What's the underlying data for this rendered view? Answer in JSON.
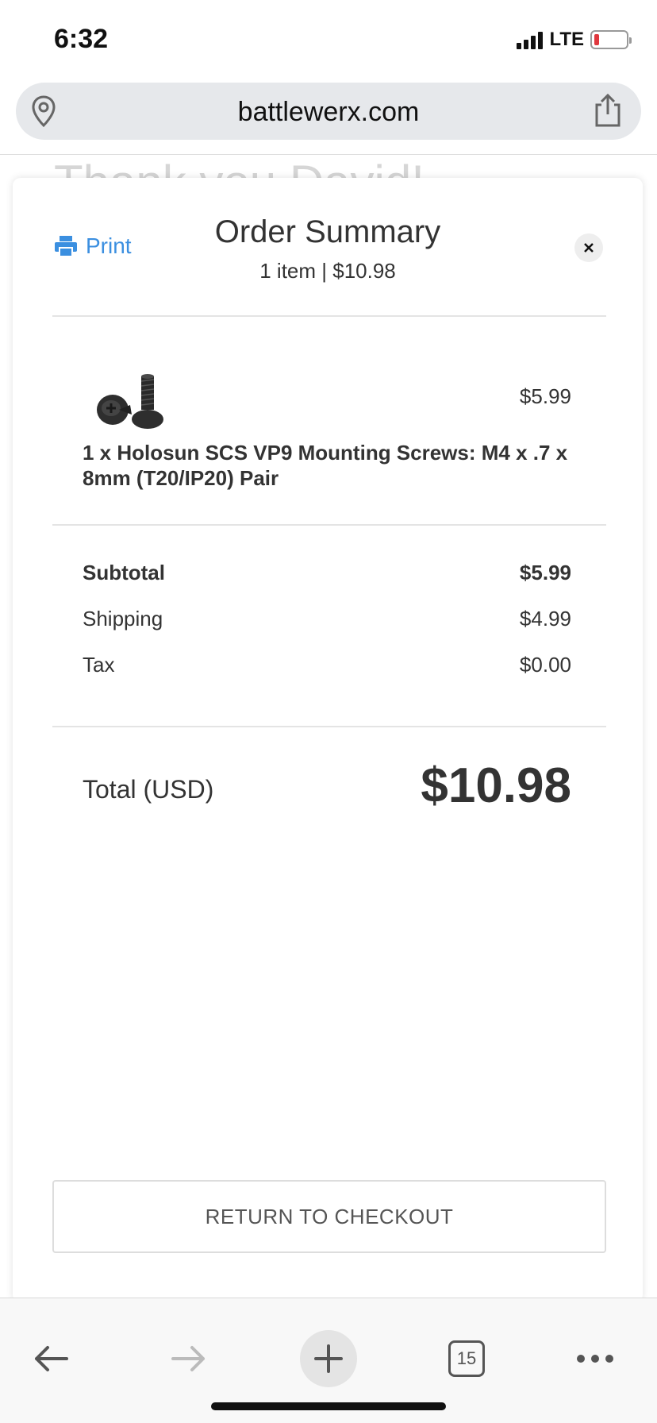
{
  "status_bar": {
    "time": "6:32",
    "network": "LTE",
    "battery_level": 0.15,
    "battery_color": "#e0383e"
  },
  "browser": {
    "url": "battlewerx.com",
    "tab_count": "15",
    "icons": {
      "location": "location-pin-icon",
      "share": "share-icon",
      "back": "back-arrow-icon",
      "forward": "forward-arrow-icon",
      "new_tab": "plus-icon",
      "tabs": "tabs-icon",
      "menu": "more-icon"
    }
  },
  "background_page": {
    "heading": "Thank you David!"
  },
  "order_summary": {
    "print_label": "Print",
    "title": "Order Summary",
    "subtitle": "1 item | $10.98",
    "items": [
      {
        "image": "holosun-screws-image",
        "price": "$5.99",
        "name": "1 x Holosun SCS VP9 Mounting Screws: M4 x .7 x 8mm (T20/IP20) Pair"
      }
    ],
    "subtotal_label": "Subtotal",
    "subtotal_value": "$5.99",
    "shipping_label": "Shipping",
    "shipping_value": "$4.99",
    "tax_label": "Tax",
    "tax_value": "$0.00",
    "total_label": "Total (USD)",
    "total_value": "$10.98",
    "return_button": "RETURN TO CHECKOUT"
  },
  "colors": {
    "accent": "#3b8fe0",
    "text": "#333333"
  }
}
